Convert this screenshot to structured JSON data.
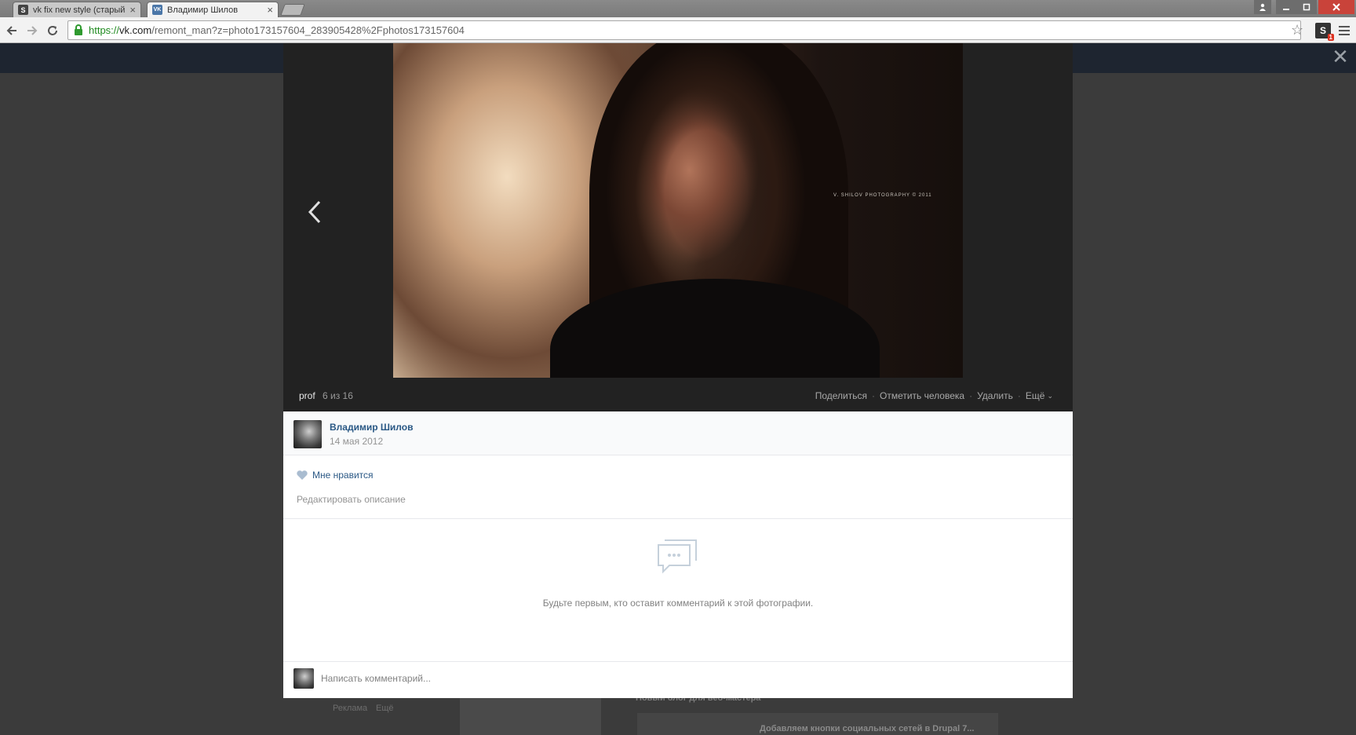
{
  "browser": {
    "tabs": [
      {
        "title": "vk fix new style (старый диза",
        "favicon": "S",
        "active": false
      },
      {
        "title": "Владимир Шилов",
        "favicon": "VK",
        "active": true
      }
    ],
    "url_scheme": "https://",
    "url_domain": "vk.com",
    "url_rest": "/remont_man?z=photo173157604_283905428%2Fphotos173157604",
    "extension_label": "S",
    "extension_badge": "1",
    "icons": [
      "back-icon",
      "forward-icon",
      "reload-icon",
      "lock-icon",
      "star-icon",
      "menu-icon",
      "user-icon",
      "minimize-icon",
      "maximize-icon",
      "close-icon"
    ]
  },
  "viewer": {
    "album": "prof",
    "counter": "6 из 16",
    "actions": {
      "share": "Поделиться",
      "tag": "Отметить человека",
      "delete": "Удалить",
      "more": "Ещё"
    },
    "watermark": "V. SHILOV PHOTOGRAPHY © 2011",
    "author": {
      "name": "Владимир Шилов",
      "date": "14 мая 2012"
    },
    "like_label": "Мне нравится",
    "edit_description": "Редактировать описание",
    "empty_comments": "Будьте первым, кто оставит комментарий к этой фотографии.",
    "comment_placeholder": "Написать комментарий..."
  },
  "background": {
    "footer_ads": "Реклама",
    "footer_more": "Ещё",
    "snippet_text": "Новый блог для веб-мастера",
    "card_title": "Добавляем кнопки социальных сетей в Drupal 7..."
  },
  "colors": {
    "vk_link": "#2a5885",
    "viewer_dark": "#222222",
    "header_dark": "#1e2530"
  }
}
